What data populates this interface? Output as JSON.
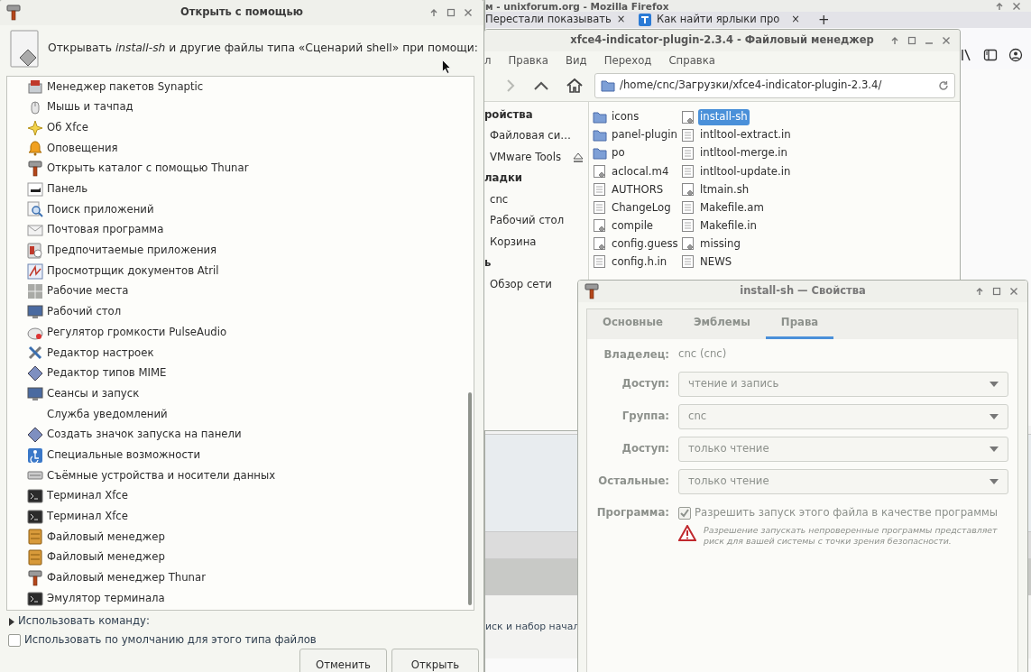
{
  "browser": {
    "title": "м - unixforum.org - Mozilla Firefox",
    "tabs": [
      {
        "label": "Перестали показывать",
        "close": "×",
        "selected": false
      },
      {
        "label": "Как найти ярлыки про",
        "close": "×",
        "selected": false
      }
    ],
    "new_tab": "+",
    "page_text": "иск и набор начал"
  },
  "file_manager": {
    "title": "xfce4-indicator-plugin-2.3.4 - Файловый менеджер",
    "menu": [
      "л",
      "Правка",
      "Вид",
      "Переход",
      "Справка"
    ],
    "path": "/home/cnc/Загрузки/xfce4-indicator-plugin-2.3.4/",
    "sidebar": [
      {
        "kind": "header",
        "label": "ройства"
      },
      {
        "kind": "item",
        "label": "Файловая си…",
        "ejectable": false
      },
      {
        "kind": "item",
        "label": "VMware Tools",
        "ejectable": true
      },
      {
        "kind": "header",
        "label": "ладки"
      },
      {
        "kind": "item",
        "label": "cnc",
        "ejectable": false
      },
      {
        "kind": "item",
        "label": "Рабочий стол",
        "ejectable": false
      },
      {
        "kind": "item",
        "label": "Корзина",
        "ejectable": false
      },
      {
        "kind": "header",
        "label": "ь"
      },
      {
        "kind": "item",
        "label": "Обзор сети",
        "ejectable": false
      }
    ],
    "files": [
      {
        "name": "icons",
        "kind": "folder",
        "selected": false
      },
      {
        "name": "panel-plugin",
        "kind": "folder",
        "selected": false
      },
      {
        "name": "po",
        "kind": "folder",
        "selected": false
      },
      {
        "name": "aclocal.m4",
        "kind": "script",
        "selected": false
      },
      {
        "name": "AUTHORS",
        "kind": "text",
        "selected": false
      },
      {
        "name": "ChangeLog",
        "kind": "text",
        "selected": false
      },
      {
        "name": "compile",
        "kind": "script",
        "selected": false
      },
      {
        "name": "config.guess",
        "kind": "script",
        "selected": false
      },
      {
        "name": "config.h.in",
        "kind": "text",
        "selected": false
      },
      {
        "name": "install-sh",
        "kind": "script",
        "selected": true
      },
      {
        "name": "intltool-extract.in",
        "kind": "text",
        "selected": false
      },
      {
        "name": "intltool-merge.in",
        "kind": "text",
        "selected": false
      },
      {
        "name": "intltool-update.in",
        "kind": "text",
        "selected": false
      },
      {
        "name": "ltmain.sh",
        "kind": "script",
        "selected": false
      },
      {
        "name": "Makefile.am",
        "kind": "text",
        "selected": false
      },
      {
        "name": "Makefile.in",
        "kind": "text",
        "selected": false
      },
      {
        "name": "missing",
        "kind": "script",
        "selected": false
      },
      {
        "name": "NEWS",
        "kind": "text",
        "selected": false
      }
    ]
  },
  "properties": {
    "title": "install-sh — Свойства",
    "disabled": true,
    "tabs": [
      {
        "label": "Основные",
        "selected": false
      },
      {
        "label": "Эмблемы",
        "selected": false
      },
      {
        "label": "Права",
        "selected": true
      }
    ],
    "owner": {
      "label": "Владелец:",
      "value": "cnc (cnc)"
    },
    "fields": [
      {
        "label": "Доступ:",
        "value": "чтение и запись"
      },
      {
        "label": "Группа:",
        "value": "cnc"
      },
      {
        "label": "Доступ:",
        "value": "только чтение"
      },
      {
        "label": "Остальные:",
        "value": "только чтение"
      }
    ],
    "program": {
      "label": "Программа:",
      "checkbox": "Разрешить запуск этого файла в качестве программы",
      "checked": true
    },
    "warning": "Разрешение запускать непроверенные программы представляет риск для вашей системы с точки зрения безопасности."
  },
  "open_with": {
    "title": "Открыть с помощью",
    "prompt": "Открывать *install-sh* и другие файлы типа «Сценарий shell» при помощи:",
    "apps": [
      {
        "label": "Менеджер пакетов Synaptic"
      },
      {
        "label": "Мышь и тачпад"
      },
      {
        "label": "Об Xfce"
      },
      {
        "label": "Оповещения"
      },
      {
        "label": "Открыть каталог с помощью Thunar"
      },
      {
        "label": "Панель"
      },
      {
        "label": "Поиск приложений"
      },
      {
        "label": "Почтовая программа"
      },
      {
        "label": "Предпочитаемые приложения"
      },
      {
        "label": "Просмотрщик документов Atril"
      },
      {
        "label": "Рабочие места"
      },
      {
        "label": "Рабочий стол"
      },
      {
        "label": "Регулятор громкости PulseAudio"
      },
      {
        "label": "Редактор настроек"
      },
      {
        "label": "Редактор типов MIME"
      },
      {
        "label": "Сеансы и запуск"
      },
      {
        "label": "Служба уведомлений"
      },
      {
        "label": "Создать значок запуска на панели"
      },
      {
        "label": "Специальные возможности"
      },
      {
        "label": "Съёмные устройства и носители данных"
      },
      {
        "label": "Терминал Xfce"
      },
      {
        "label": "Терминал Xfce"
      },
      {
        "label": "Файловый менеджер"
      },
      {
        "label": "Файловый менеджер"
      },
      {
        "label": "Файловый менеджер Thunar"
      },
      {
        "label": "Эмулятор терминала"
      }
    ],
    "use_command": {
      "label": "Использовать команду:",
      "expanded": false
    },
    "default": {
      "label": "Использовать по умолчанию для этого типа файлов",
      "checked": false
    },
    "buttons": [
      "Отменить",
      "Открыть"
    ]
  }
}
